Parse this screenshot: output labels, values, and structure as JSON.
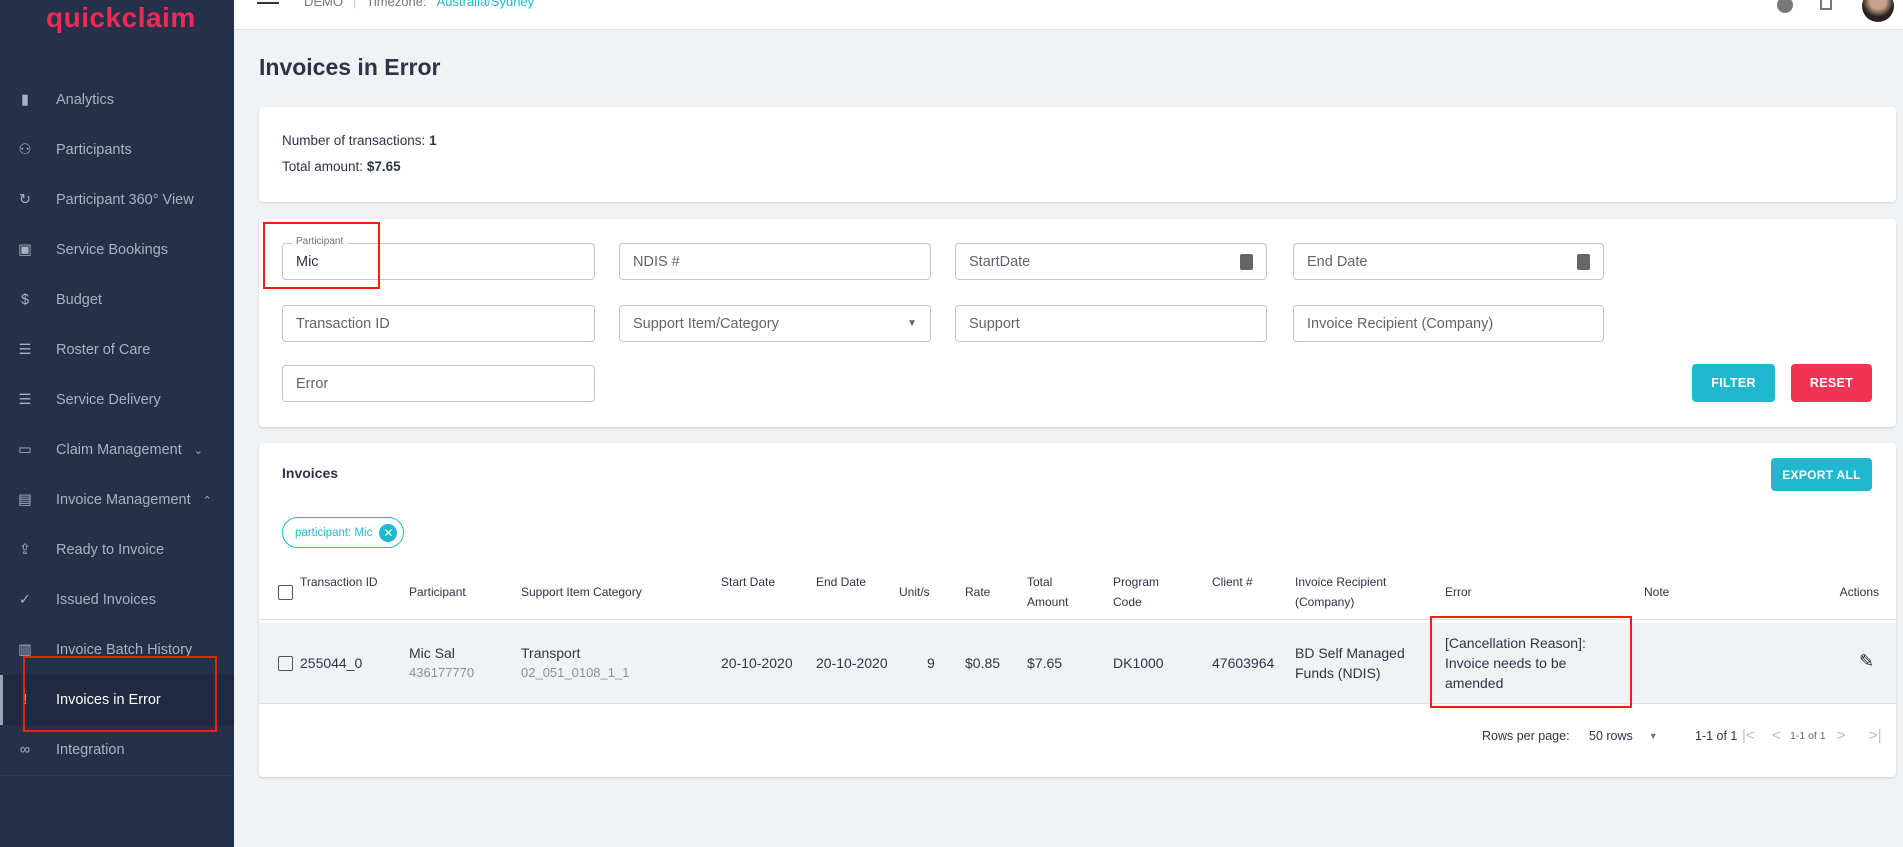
{
  "app": {
    "logo": "quickclaim",
    "org": "DEMO",
    "timezone_label": "Timezone:",
    "timezone": "Australia/Sydney"
  },
  "sidebar": {
    "items": [
      {
        "label": "Analytics",
        "icon": "analytics-icon"
      },
      {
        "label": "Participants",
        "icon": "participants-icon"
      },
      {
        "label": "Participant 360° View",
        "icon": "360-view-icon"
      },
      {
        "label": "Service Bookings",
        "icon": "calendar-check-icon"
      },
      {
        "label": "Budget",
        "icon": "dollar-icon"
      },
      {
        "label": "Roster of Care",
        "icon": "list-icon"
      },
      {
        "label": "Service Delivery",
        "icon": "list-icon"
      },
      {
        "label": "Claim Management",
        "icon": "money-icon",
        "chevron": "down"
      },
      {
        "label": "Invoice Management",
        "icon": "document-icon",
        "chevron": "up"
      },
      {
        "label": "Ready to Invoice",
        "icon": "file-upload-icon"
      },
      {
        "label": "Issued Invoices",
        "icon": "file-check-icon"
      },
      {
        "label": "Invoice Batch History",
        "icon": "archive-icon"
      },
      {
        "label": "Invoices in Error",
        "icon": "error-file-icon",
        "active": true
      },
      {
        "label": "Integration",
        "icon": "link-icon"
      }
    ]
  },
  "page": {
    "title": "Invoices in Error"
  },
  "summary": {
    "count_label": "Number of transactions:",
    "count": "1",
    "amount_label": "Total amount:",
    "amount": "$7.65"
  },
  "filters": {
    "participant_label": "Participant",
    "participant_value": "Mic",
    "ndis": "NDIS #",
    "start_date": "StartDate",
    "end_date": "End Date",
    "transaction_id": "Transaction ID",
    "support_item": "Support Item/Category",
    "support": "Support",
    "invoice_recipient": "Invoice Recipient (Company)",
    "error": "Error",
    "filter_button": "FILTER",
    "reset_button": "RESET"
  },
  "invoices": {
    "title": "Invoices",
    "export_button": "EXPORT ALL",
    "chip": "participant: Mic",
    "columns": [
      "Transaction ID",
      "Participant",
      "Support Item Category",
      "Start Date",
      "End Date",
      "Unit/s",
      "Rate",
      "Total Amount",
      "Program Code",
      "Client #",
      "Invoice Recipient (Company)",
      "Error",
      "Note",
      "Actions"
    ],
    "rows": [
      {
        "transaction_id": "255044_0",
        "participant": "Mic Sal",
        "participant_id": "436177770",
        "support_category": "Transport",
        "support_code": "02_051_0108_1_1",
        "start_date": "20-10-2020",
        "end_date": "20-10-2020",
        "units": "9",
        "rate": "$0.85",
        "total": "$7.65",
        "program_code": "DK1000",
        "client": "47603964",
        "recipient": "BD Self Managed Funds (NDIS)",
        "error": "[Cancellation Reason]: Invoice needs to be amended",
        "note": ""
      }
    ],
    "pagination": {
      "rows_label": "Rows per page:",
      "rows_value": "50 rows",
      "range": "1-1 of 1",
      "range_small": "1-1 of 1"
    }
  },
  "colors": {
    "sidebar": "#253049",
    "brand": "#ef2b55",
    "accent": "#1fb8cf",
    "danger": "#ef3456"
  }
}
